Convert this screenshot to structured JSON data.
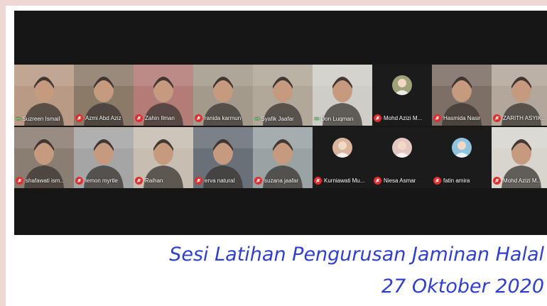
{
  "meeting": {
    "participants": [
      {
        "name": "Suzreen Ismail",
        "status": "speaking",
        "video": true,
        "tone": "#b89a85"
      },
      {
        "name": "Azmi Abd Aziz",
        "status": "muted",
        "video": true,
        "tone": "#8c7a69"
      },
      {
        "name": "Zahin Ilman",
        "status": "muted",
        "video": true,
        "tone": "#b47c77"
      },
      {
        "name": "ranida karmun",
        "status": "muted",
        "video": true,
        "tone": "#a49a8c"
      },
      {
        "name": "Syafik Jaafar",
        "status": "speaking",
        "video": true,
        "tone": "#b2a89a"
      },
      {
        "name": "Don Luqman",
        "status": "speaking",
        "video": true,
        "tone": "#cfcdc8"
      },
      {
        "name": "Mohd Azizi M...",
        "status": "muted",
        "video": false,
        "tone": "#a0a27a"
      },
      {
        "name": "Hasmida Nasir",
        "status": "muted",
        "video": true,
        "tone": "#7d6e66"
      },
      {
        "name": "ZARITH ASYIK...",
        "status": "muted",
        "video": true,
        "tone": "#b3a79b"
      },
      {
        "name": "shafawati ism...",
        "status": "muted",
        "video": true,
        "tone": "#8a7d72"
      },
      {
        "name": "lemon myrtle",
        "status": "muted",
        "video": true,
        "tone": "#a5a5a5"
      },
      {
        "name": "Raihan",
        "status": "muted",
        "video": true,
        "tone": "#c7bdb0"
      },
      {
        "name": "erva natural",
        "status": "muted",
        "video": true,
        "tone": "#6a7078"
      },
      {
        "name": "suzana jaafar",
        "status": "muted",
        "video": true,
        "tone": "#9aa2a3"
      },
      {
        "name": "Kurniawati Mu...",
        "status": "muted",
        "video": false,
        "tone": "#d9b59e"
      },
      {
        "name": "Niesa Asmar",
        "status": "muted",
        "video": false,
        "tone": "#e4c6c2"
      },
      {
        "name": "fatin amira",
        "status": "muted",
        "video": false,
        "tone": "#8fc3de"
      },
      {
        "name": "Mohd Azizi M...",
        "status": "muted",
        "video": true,
        "tone": "#d8d5cf"
      }
    ]
  },
  "caption": {
    "line1": "Sesi Latihan Pengurusan Jaminan Halal",
    "line2": "27 Oktober 2020"
  },
  "icons": {
    "muted": "microphone-muted-icon",
    "speaking": "audio-activity-icon"
  },
  "colors": {
    "caption": "#2f3fd0",
    "muted_badge": "#e02e2e",
    "active_border": "#5fd35f"
  }
}
